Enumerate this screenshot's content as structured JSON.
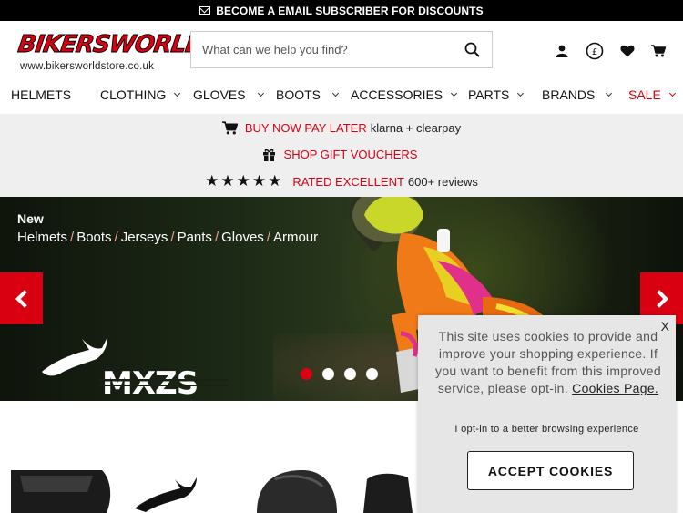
{
  "topbar": {
    "icon": "mail-icon",
    "text": "BECOME A EMAIL SUBSCRIBER FOR DISCOUNTS"
  },
  "logo": {
    "word": "BIKERSWORLD",
    "url": "www.bikersworldstore.co.uk"
  },
  "search": {
    "placeholder": "What can we help you find?",
    "value": ""
  },
  "header_icons": [
    "account-icon",
    "currency-pound-icon",
    "wishlist-heart-icon",
    "cart-icon"
  ],
  "currency_symbol": "£",
  "nav": [
    {
      "label": "HELMETS"
    },
    {
      "label": "CLOTHING"
    },
    {
      "label": "GLOVES"
    },
    {
      "label": "BOOTS"
    },
    {
      "label": "ACCESSORIES"
    },
    {
      "label": "PARTS"
    },
    {
      "label": "BRANDS"
    },
    {
      "label": "SALE"
    }
  ],
  "usp": {
    "klarna": {
      "highlight": "BUY NOW PAY LATER",
      "rest": "klarna + clearpay"
    },
    "vouchers": {
      "highlight": "SHOP GIFT VOUCHERS"
    },
    "rating": {
      "stars": "★★★★★",
      "highlight": "RATED EXCELLENT",
      "rest": "600+ reviews"
    }
  },
  "hero": {
    "new_label": "New",
    "categories": [
      "Helmets",
      "Boots",
      "Jerseys",
      "Pants",
      "Gloves",
      "Armour"
    ],
    "separator": "/",
    "brand_text": "MXZS",
    "slide_count": 4,
    "active_slide": 1
  },
  "cookie": {
    "close": "X",
    "message": "This site uses cookies to provide and improve your shopping experience. If you want to benefit from this improved service, please opt-in.",
    "link": "Cookies Page.",
    "optin": "I opt-in to a better browsing experience",
    "button": "ACCEPT COOKIES"
  },
  "colors": {
    "accent": "#d90012",
    "topbar": "#000000",
    "usp_bg": "#efefef",
    "cookie_bg": "#e6e6e6"
  }
}
